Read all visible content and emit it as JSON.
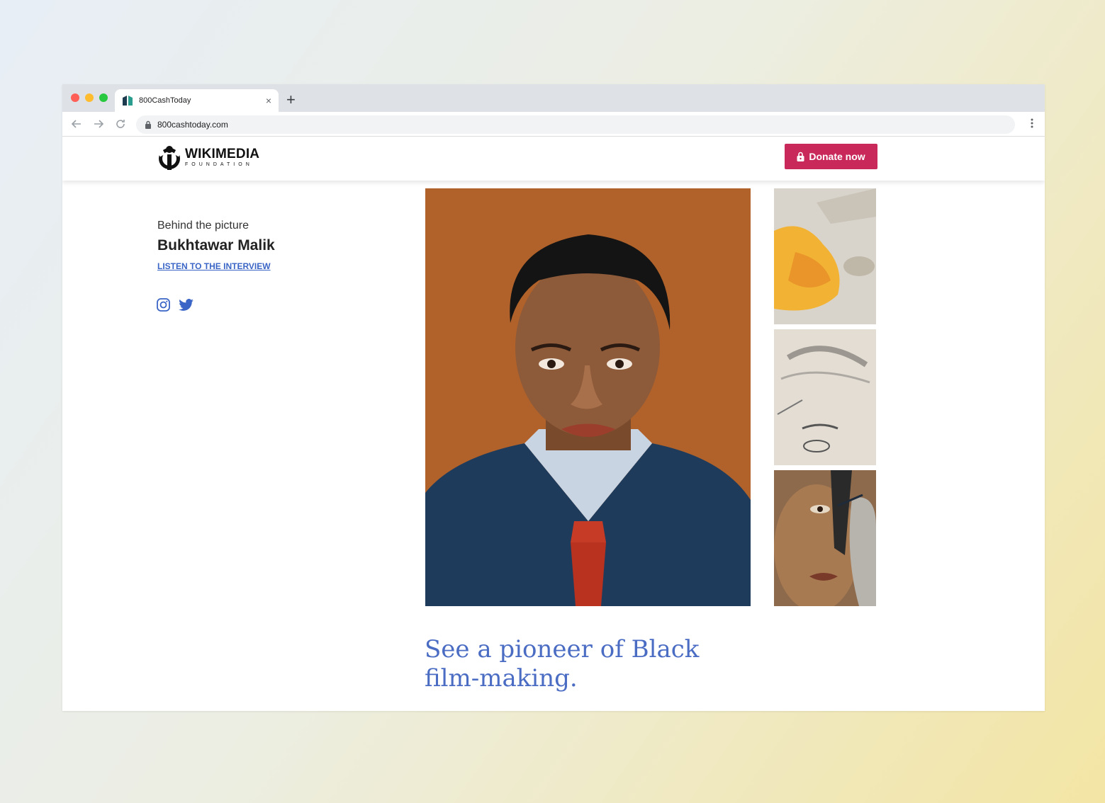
{
  "browser": {
    "tab_title": "800CashToday",
    "new_tab_glyph": "+",
    "close_glyph": "×",
    "url": "800cashtoday.com",
    "window_controls": {
      "close": "#ff5f57",
      "minimize": "#febc2e",
      "maximize": "#28c840"
    }
  },
  "site": {
    "logo_main": "WIKIMEDIA",
    "logo_sub": "FOUNDATION",
    "donate_label": "Donate now",
    "accent_color": "#c8285a",
    "link_color": "#3a65c6"
  },
  "article": {
    "kicker": "Behind the picture",
    "name": "Bukhtawar Malik",
    "listen_link": "LISTEN TO THE INTERVIEW",
    "headline": "See a pioneer of Black film-making.",
    "social_icons": [
      "instagram-icon",
      "twitter-icon"
    ]
  }
}
